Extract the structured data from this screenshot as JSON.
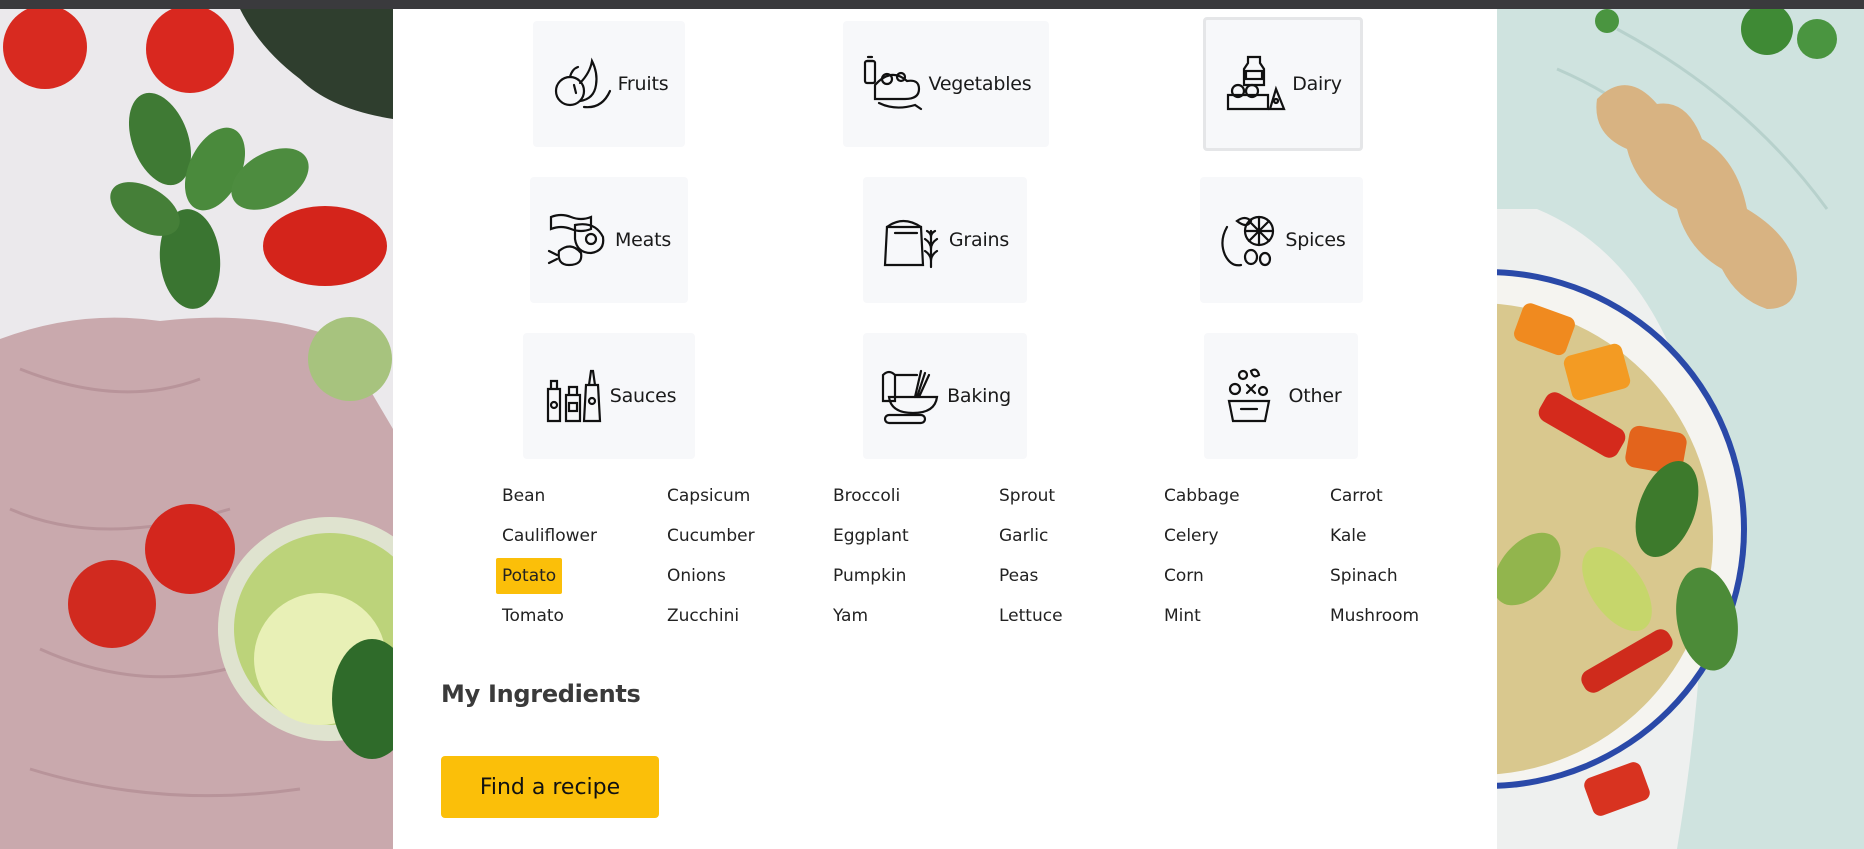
{
  "categories": [
    {
      "label": "Fruits",
      "icon": "fruits-icon",
      "selected": false
    },
    {
      "label": "Vegetables",
      "icon": "vegetables-icon",
      "selected": false
    },
    {
      "label": "Dairy",
      "icon": "dairy-icon",
      "selected": true
    },
    {
      "label": "Meats",
      "icon": "meats-icon",
      "selected": false
    },
    {
      "label": "Grains",
      "icon": "grains-icon",
      "selected": false
    },
    {
      "label": "Spices",
      "icon": "spices-icon",
      "selected": false
    },
    {
      "label": "Sauces",
      "icon": "sauces-icon",
      "selected": false
    },
    {
      "label": "Baking",
      "icon": "baking-icon",
      "selected": false
    },
    {
      "label": "Other",
      "icon": "other-icon",
      "selected": false
    }
  ],
  "ingredients": [
    "Bean",
    "Capsicum",
    "Broccoli",
    "Sprout",
    "Cabbage",
    "Carrot",
    "Cauliflower",
    "Cucumber",
    "Eggplant",
    "Garlic",
    "Celery",
    "Kale",
    "Potato",
    "Onions",
    "Pumpkin",
    "Peas",
    "Corn",
    "Spinach",
    "Tomato",
    "Zucchini",
    "Yam",
    "Lettuce",
    "Mint",
    "Mushroom"
  ],
  "selected_ingredient": "Potato",
  "my_ingredients": {
    "title": "My Ingredients",
    "button_label": "Find a recipe"
  },
  "colors": {
    "accent": "#fbbf09",
    "tile_bg": "#f7f8fa"
  }
}
